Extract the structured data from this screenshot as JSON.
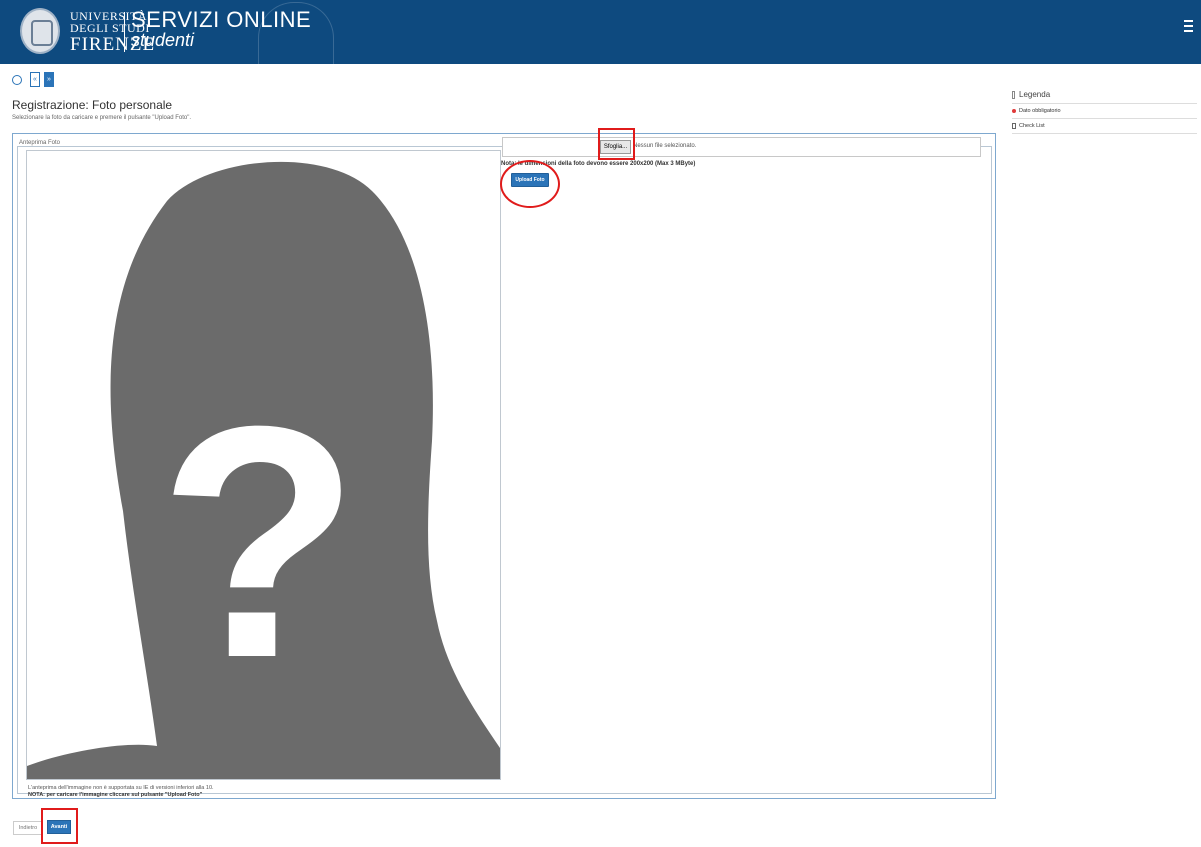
{
  "header": {
    "logo_line1": "UNIVERSITÀ",
    "logo_line2": "DEGLI STUDI",
    "logo_line3": "FIRENZE",
    "service_title": "SERVIZI ONLINE",
    "service_subtitle": "studenti",
    "background": "#0e4a7f"
  },
  "toolbar": {
    "icons": [
      "home-icon",
      "prev-page-button",
      "next-page-button"
    ],
    "prev_symbol": "«",
    "next_symbol": "»"
  },
  "page": {
    "title": "Registrazione: Foto personale",
    "instruction": "Selezionare la foto da caricare e premere il pulsante \"Upload Foto\"."
  },
  "form": {
    "fieldset_label": "Anteprima Foto",
    "file_button_label": "Sfoglia...",
    "file_status": "Nessun file selezionato.",
    "note": "Nota: le dimensioni della foto devono essere 200x200 (Max 3 MByte)",
    "upload_button_label": "Upload Foto",
    "info_line": "L'anteprima dell'immagine non è supportata su IE di versioni inferiori alla 10.",
    "note_cancel": "NOTA: per caricare l'immagine cliccare sul pulsante \"Upload Foto\"",
    "placeholder_symbol": "?"
  },
  "footer": {
    "back_label": "Indietro",
    "next_label": "Avanti"
  },
  "legend": {
    "title": "Legenda",
    "items": [
      {
        "label": "Dato obbligatorio",
        "icon": "required-dot-icon"
      },
      {
        "label": "Check List",
        "icon": "checklist-icon"
      }
    ]
  },
  "colors": {
    "primary_blue": "#2b74b8",
    "annotation_red": "#e01b1b"
  }
}
